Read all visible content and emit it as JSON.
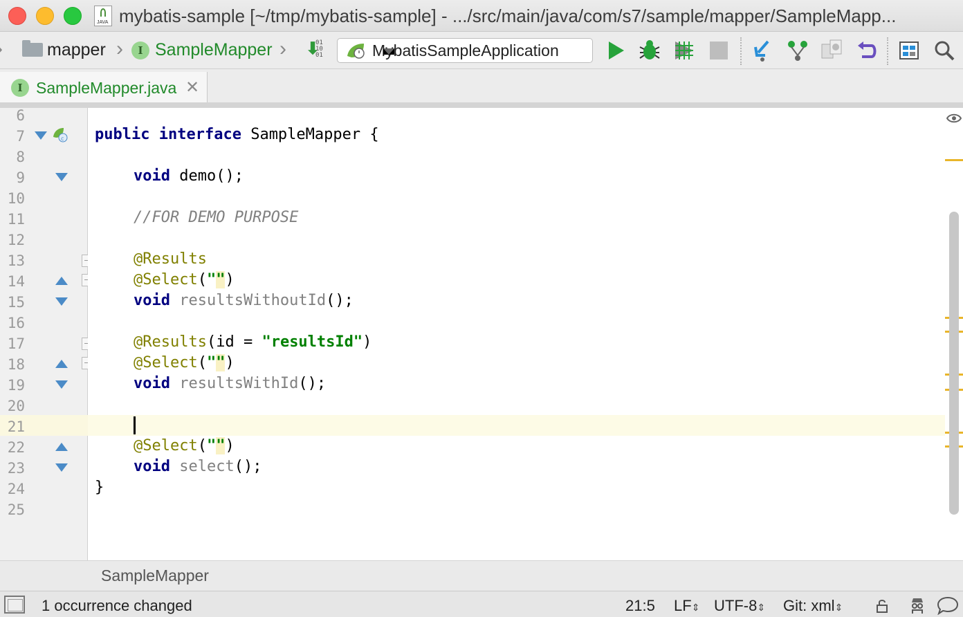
{
  "window": {
    "title": "mybatis-sample [~/tmp/mybatis-sample] - .../src/main/java/com/s7/sample/mapper/SampleMapp...",
    "file_icon_label": "JAVA"
  },
  "navbar": {
    "crumbs": [
      {
        "label": "mapper",
        "icon": "folder-icon"
      },
      {
        "label": "SampleMapper",
        "icon": "interface-icon"
      }
    ],
    "interface_badge": "I",
    "sort_bits": "01\n10\n01",
    "run_config": "MybatisSampleApplication",
    "toolbar_icons": [
      "sort-icon",
      "run-icon",
      "debug-icon",
      "coverage-icon",
      "stop-icon",
      "vcs-update-icon",
      "vcs-commit-icon",
      "vcs-compare-icon",
      "revert-icon",
      "project-structure-icon",
      "search-icon"
    ]
  },
  "tabs": [
    {
      "label": "SampleMapper.java",
      "badge": "I",
      "active": true
    }
  ],
  "editor": {
    "lines": [
      {
        "num": "6"
      },
      {
        "num": "7"
      },
      {
        "num": "8"
      },
      {
        "num": "9"
      },
      {
        "num": "10"
      },
      {
        "num": "11"
      },
      {
        "num": "12"
      },
      {
        "num": "13"
      },
      {
        "num": "14"
      },
      {
        "num": "15"
      },
      {
        "num": "16"
      },
      {
        "num": "17"
      },
      {
        "num": "18"
      },
      {
        "num": "19"
      },
      {
        "num": "20"
      },
      {
        "num": "21"
      },
      {
        "num": "22"
      },
      {
        "num": "23"
      },
      {
        "num": "24"
      },
      {
        "num": "25"
      }
    ],
    "code": {
      "l7_kw1": "public",
      "l7_kw2": "interface",
      "l7_rest": " SampleMapper {",
      "l9_kw": "void",
      "l9_rest": " demo();",
      "l11_comment": "//FOR DEMO PURPOSE",
      "l13_ann": "@Results",
      "l14_ann": "@Select",
      "l14_open": "(",
      "l14_q1": "\"",
      "l14_q2": "\"",
      "l14_close": ")",
      "l15_kw": "void",
      "l15_name": "resultsWithoutId",
      "l15_rest": "();",
      "l17_ann": "@Results",
      "l17_mid": "(id = ",
      "l17_str": "\"resultsId\"",
      "l17_close": ")",
      "l18_ann": "@Select",
      "l18_open": "(",
      "l18_q1": "\"",
      "l18_q2": "\"",
      "l18_close": ")",
      "l19_kw": "void",
      "l19_name": "resultsWithId",
      "l19_rest": "();",
      "l22_ann": "@Select",
      "l22_open": "(",
      "l22_q1": "\"",
      "l22_q2": "\"",
      "l22_close": ")",
      "l23_kw": "void",
      "l23_name": "select",
      "l23_rest": "();",
      "l24_brace": "}"
    }
  },
  "footer_breadcrumb": "SampleMapper",
  "status": {
    "message": "1 occurrence changed",
    "position": "21:5",
    "line_separator": "LF",
    "encoding": "UTF-8",
    "vcs_branch": "Git: xml",
    "updown_glyph": "⇕"
  },
  "colors": {
    "keyword": "#000080",
    "annotation": "#808000",
    "string": "#008000",
    "comment": "#808080",
    "current_line": "#fdfbe6",
    "stripe_warning": "#e9b52a"
  }
}
